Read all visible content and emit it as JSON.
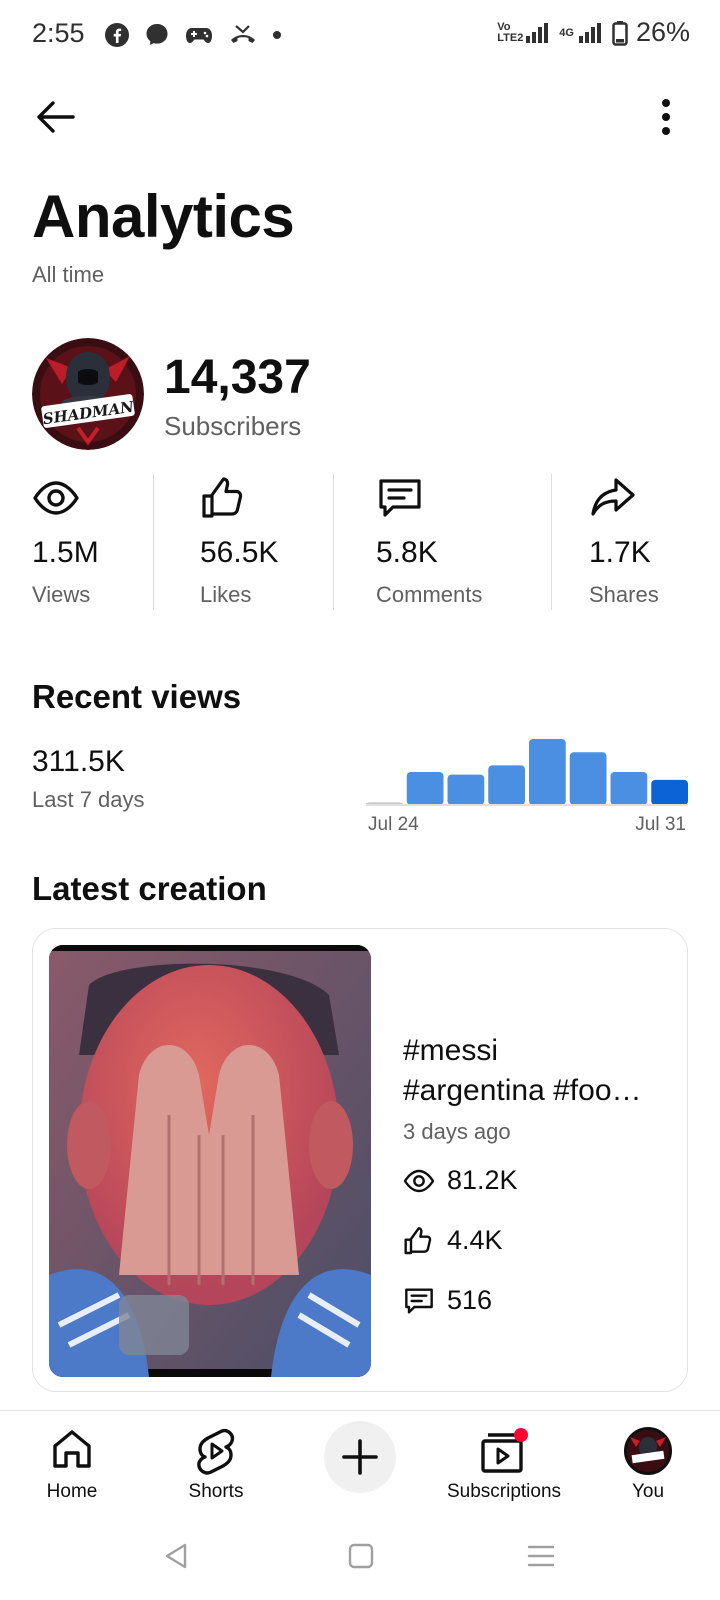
{
  "status_bar": {
    "time": "2:55",
    "volte": "Vo LTE2",
    "network": "4G",
    "battery": "26%"
  },
  "header": {
    "title": "Analytics",
    "subtitle": "All time"
  },
  "channel": {
    "avatar_text": "SHADMAN",
    "subscribers": "14,337",
    "subscribers_label": "Subscribers"
  },
  "stats": [
    {
      "icon": "eye-icon",
      "value": "1.5M",
      "label": "Views"
    },
    {
      "icon": "thumbs-up-icon",
      "value": "56.5K",
      "label": "Likes"
    },
    {
      "icon": "comment-icon",
      "value": "5.8K",
      "label": "Comments"
    },
    {
      "icon": "share-icon",
      "value": "1.7K",
      "label": "Shares"
    }
  ],
  "recent_views": {
    "title": "Recent views",
    "value": "311.5K",
    "caption": "Last 7 days",
    "start_label": "Jul 24",
    "end_label": "Jul 31",
    "bar_color": "#4b8fe2",
    "highlight_color": "#0b63d6"
  },
  "chart_data": {
    "type": "bar",
    "title": "",
    "xlabel": "",
    "ylabel": "",
    "x_tick_labels": [
      "Jul 24",
      "Jul 31"
    ],
    "values": [
      0.04,
      0.5,
      0.46,
      0.6,
      1.0,
      0.8,
      0.5,
      0.38
    ],
    "highlight_index": 7,
    "ylim": [
      0,
      1
    ],
    "grid": false
  },
  "latest_creation": {
    "title": "Latest creation",
    "video_title_line1": "#messi",
    "video_title_line2": "#argentina #foo…",
    "age": "3 days ago",
    "views": "81.2K",
    "likes": "4.4K",
    "comments": "516"
  },
  "bottom_nav": {
    "home": "Home",
    "shorts": "Shorts",
    "subscriptions": "Subscriptions",
    "you": "You"
  },
  "colors": {
    "text_primary": "#0f0f0f",
    "text_secondary": "#606060",
    "notification_dot": "#ff0033"
  }
}
